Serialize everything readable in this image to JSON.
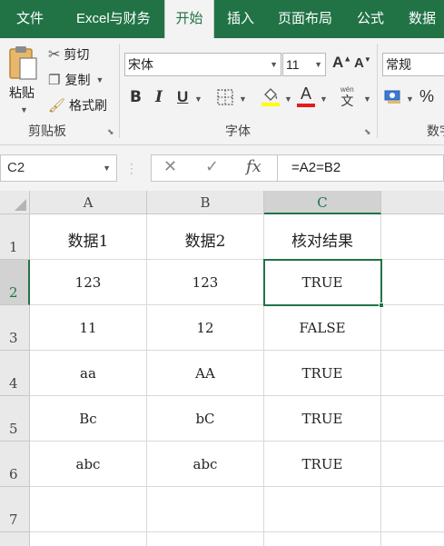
{
  "ribbon_tabs": [
    "文件",
    "Excel与财务",
    "开始",
    "插入",
    "页面布局",
    "公式",
    "数据"
  ],
  "active_tab": "开始",
  "clipboard": {
    "paste_label": "粘贴",
    "cut_label": "剪切",
    "copy_label": "复制",
    "format_painter_label": "格式刷",
    "group_label": "剪贴板"
  },
  "font": {
    "font_name": "宋体",
    "font_size": "11",
    "grow_label": "A",
    "shrink_label": "A",
    "bold_label": "B",
    "italic_label": "I",
    "underline_label": "U",
    "font_color_label": "A",
    "phonetic_label": "文",
    "phonetic_top": "wén",
    "group_label": "字体",
    "accent_yellow": "#ffff00",
    "accent_red": "#e31b1b"
  },
  "number": {
    "format": "常规",
    "percent_label": "%",
    "group_label": "数字"
  },
  "formula_bar": {
    "name_box": "C2",
    "cancel_label": "✕",
    "enter_label": "✓",
    "fx_label": "fx",
    "formula": "=A2=B2"
  },
  "sheet": {
    "columns": [
      "A",
      "B",
      "C"
    ],
    "selected_column": "C",
    "rows": [
      "1",
      "2",
      "3",
      "4",
      "5",
      "6",
      "7"
    ],
    "selected_row": "2",
    "cells": [
      [
        "数据1",
        "数据2",
        "核对结果"
      ],
      [
        "123",
        "123",
        "TRUE"
      ],
      [
        "11",
        "12",
        "FALSE"
      ],
      [
        "aa",
        "AA",
        "TRUE"
      ],
      [
        "Bc",
        "bC",
        "TRUE"
      ],
      [
        "abc",
        "abc",
        "TRUE"
      ],
      [
        "",
        "",
        ""
      ]
    ]
  },
  "colors": {
    "brand_green": "#217346"
  }
}
